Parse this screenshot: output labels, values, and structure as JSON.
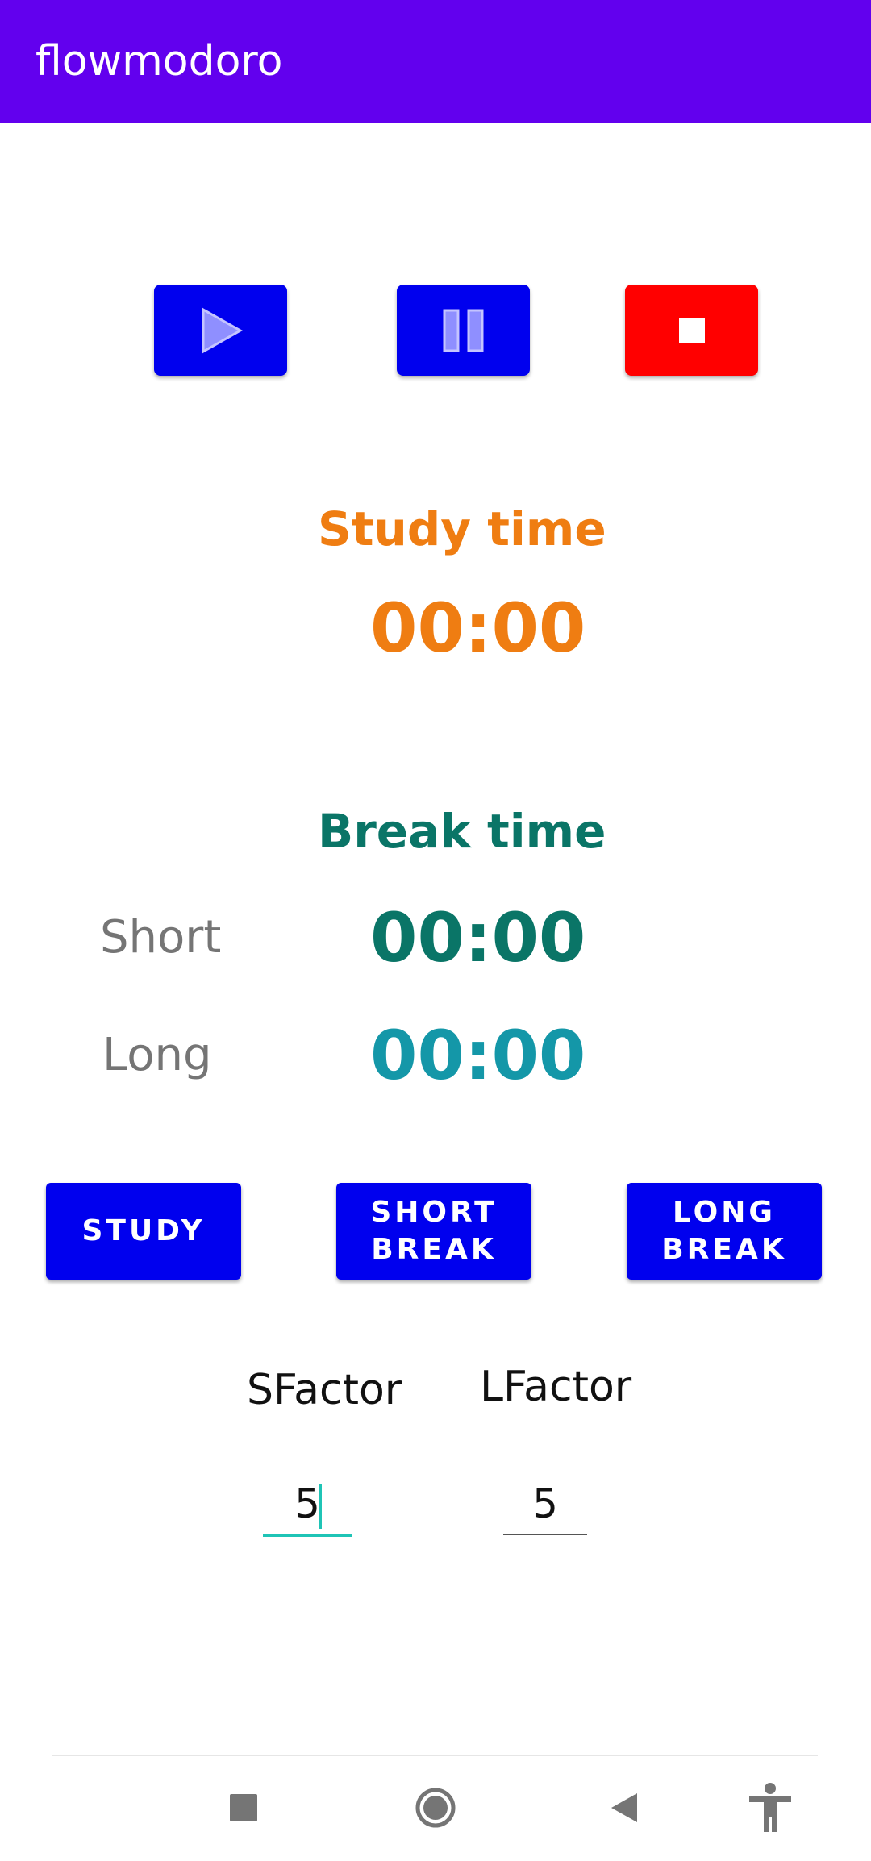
{
  "app_bar": {
    "title": "flowmodoro",
    "color": "#6200ee"
  },
  "controls": {
    "play": {
      "icon": "play-icon",
      "color": "#0000ee"
    },
    "pause": {
      "icon": "pause-icon",
      "color": "#0000ee"
    },
    "stop": {
      "icon": "stop-icon",
      "color": "#ff0000"
    }
  },
  "study": {
    "label": "Study time",
    "timer": "00:00",
    "color": "#ef7d12"
  },
  "break": {
    "label": "Break time",
    "color": "#0a7567",
    "short": {
      "label": "Short",
      "timer": "00:00",
      "color": "#0a7567"
    },
    "long": {
      "label": "Long",
      "timer": "00:00",
      "color": "#1497a8"
    }
  },
  "modes": {
    "study": "STUDY",
    "short_break": "SHORT\nBREAK",
    "long_break": "LONG\nBREAK"
  },
  "factors": {
    "s_label": "SFactor",
    "l_label": "LFactor",
    "s_value": "5",
    "l_value": "5",
    "focus_color": "#1fc4b6"
  },
  "nav_bar": {
    "icons": [
      "recents-icon",
      "home-icon",
      "back-icon",
      "accessibility-icon"
    ]
  }
}
